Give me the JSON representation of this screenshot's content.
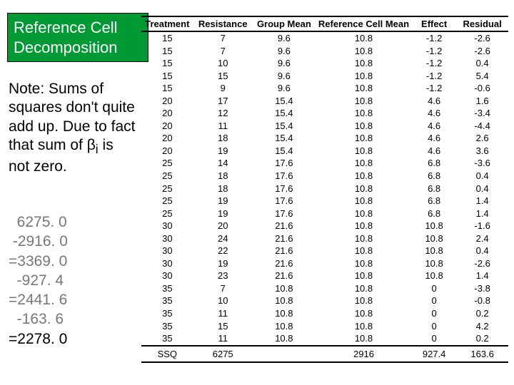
{
  "title_l1": "Reference Cell",
  "title_l2": "Decomposition",
  "note": "Note: Sums of squares don't quite add up. Due to fact that sum of β",
  "note_sub": "i",
  "note_tail": " is not zero.",
  "calc": {
    "l1": "  6275. 0",
    "l2": " -2916. 0",
    "l3": "=3369. 0",
    "l4": "  -927. 4",
    "l5": "=2441. 6",
    "l6": "  -163. 6",
    "l7": "=2278. 0"
  },
  "headers": [
    "Treatment",
    "Resistance",
    "Group Mean",
    "Reference Cell Mean",
    "Effect",
    "Residual"
  ],
  "rows": [
    [
      "15",
      "7",
      "9.6",
      "10.8",
      "-1.2",
      "-2.6"
    ],
    [
      "15",
      "7",
      "9.6",
      "10.8",
      "-1.2",
      "-2.6"
    ],
    [
      "15",
      "10",
      "9.6",
      "10.8",
      "-1.2",
      "0.4"
    ],
    [
      "15",
      "15",
      "9.6",
      "10.8",
      "-1.2",
      "5.4"
    ],
    [
      "15",
      "9",
      "9.6",
      "10.8",
      "-1.2",
      "-0.6"
    ],
    [
      "20",
      "17",
      "15.4",
      "10.8",
      "4.6",
      "1.6"
    ],
    [
      "20",
      "12",
      "15.4",
      "10.8",
      "4.6",
      "-3.4"
    ],
    [
      "20",
      "11",
      "15.4",
      "10.8",
      "4.6",
      "-4.4"
    ],
    [
      "20",
      "18",
      "15.4",
      "10.8",
      "4.6",
      "2.6"
    ],
    [
      "20",
      "19",
      "15.4",
      "10.8",
      "4.6",
      "3.6"
    ],
    [
      "25",
      "14",
      "17.6",
      "10.8",
      "6.8",
      "-3.6"
    ],
    [
      "25",
      "18",
      "17.6",
      "10.8",
      "6.8",
      "0.4"
    ],
    [
      "25",
      "18",
      "17.6",
      "10.8",
      "6.8",
      "0.4"
    ],
    [
      "25",
      "19",
      "17.6",
      "10.8",
      "6.8",
      "1.4"
    ],
    [
      "25",
      "19",
      "17.6",
      "10.8",
      "6.8",
      "1.4"
    ],
    [
      "30",
      "20",
      "21.6",
      "10.8",
      "10.8",
      "-1.6"
    ],
    [
      "30",
      "24",
      "21.6",
      "10.8",
      "10.8",
      "2.4"
    ],
    [
      "30",
      "22",
      "21.6",
      "10.8",
      "10.8",
      "0.4"
    ],
    [
      "30",
      "19",
      "21.6",
      "10.8",
      "10.8",
      "-2.6"
    ],
    [
      "30",
      "23",
      "21.6",
      "10.8",
      "10.8",
      "1.4"
    ],
    [
      "35",
      "7",
      "10.8",
      "10.8",
      "0",
      "-3.8"
    ],
    [
      "35",
      "10",
      "10.8",
      "10.8",
      "0",
      "-0.8"
    ],
    [
      "35",
      "11",
      "10.8",
      "10.8",
      "0",
      "0.2"
    ],
    [
      "35",
      "15",
      "10.8",
      "10.8",
      "0",
      "4.2"
    ],
    [
      "35",
      "11",
      "10.8",
      "10.8",
      "0",
      "0.2"
    ]
  ],
  "footer": [
    "",
    "SSQ",
    "6275",
    "",
    "2916",
    "927.4",
    "163.6"
  ]
}
